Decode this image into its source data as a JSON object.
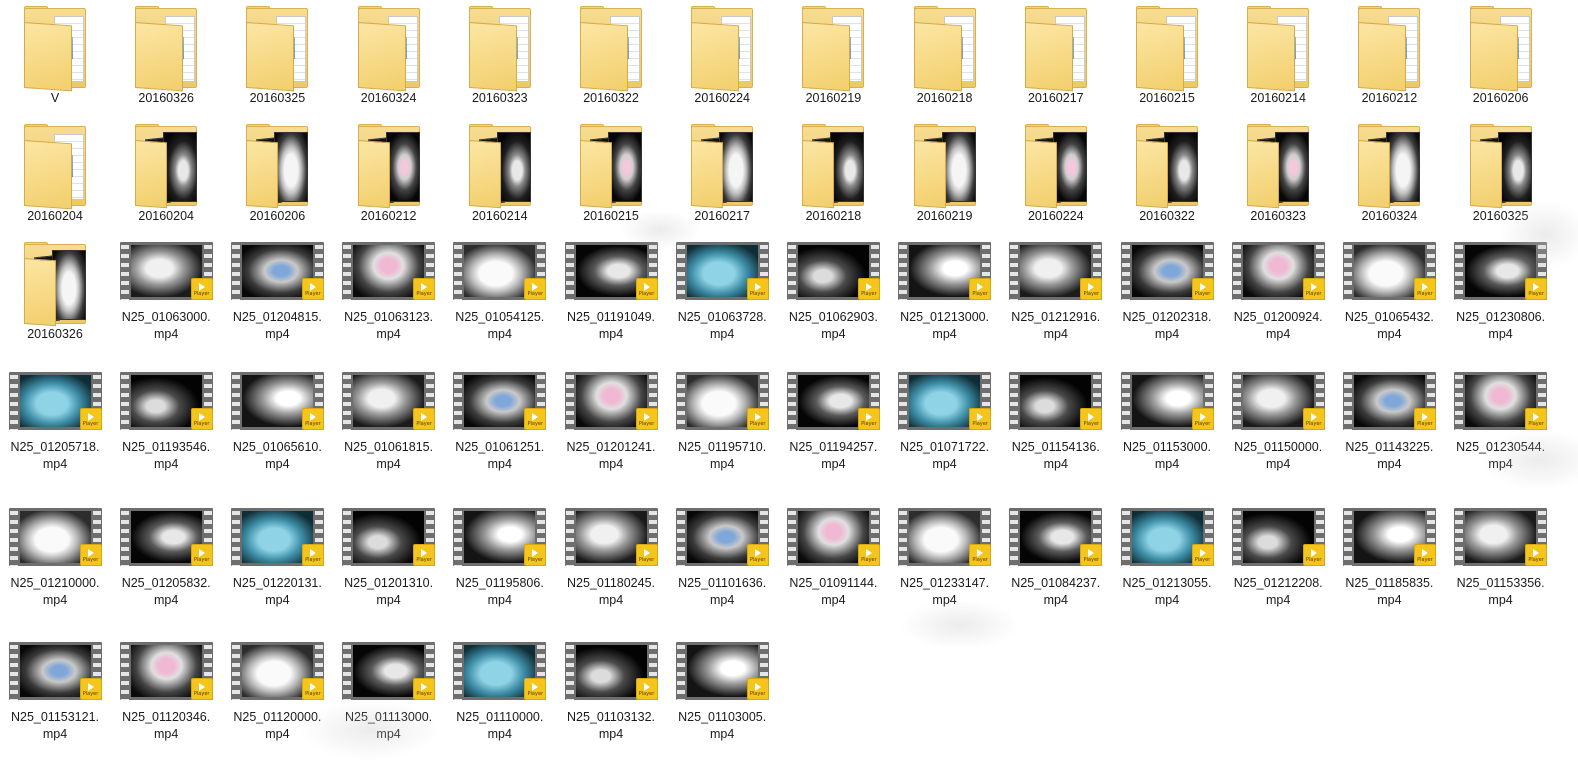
{
  "explorer": {
    "rows": [
      [
        {
          "kind": "folder",
          "label": "V"
        },
        {
          "kind": "folder",
          "label": "20160326"
        },
        {
          "kind": "folder",
          "label": "20160325"
        },
        {
          "kind": "folder",
          "label": "20160324"
        },
        {
          "kind": "folder",
          "label": "20160323"
        },
        {
          "kind": "folder",
          "label": "20160322"
        },
        {
          "kind": "folder",
          "label": "20160224"
        },
        {
          "kind": "folder",
          "label": "20160219"
        },
        {
          "kind": "folder",
          "label": "20160218"
        },
        {
          "kind": "folder",
          "label": "20160217"
        },
        {
          "kind": "folder",
          "label": "20160215"
        },
        {
          "kind": "folder",
          "label": "20160214"
        },
        {
          "kind": "folder",
          "label": "20160212"
        },
        {
          "kind": "folder",
          "label": "20160206"
        }
      ],
      [
        {
          "kind": "folder",
          "label": "20160204"
        },
        {
          "kind": "folder-photo",
          "label": "20160204"
        },
        {
          "kind": "folder-photo",
          "label": "20160206"
        },
        {
          "kind": "folder-photo",
          "label": "20160212"
        },
        {
          "kind": "folder-photo",
          "label": "20160214"
        },
        {
          "kind": "folder-photo",
          "label": "20160215"
        },
        {
          "kind": "folder-photo",
          "label": "20160217"
        },
        {
          "kind": "folder-photo",
          "label": "20160218"
        },
        {
          "kind": "folder-photo",
          "label": "20160219"
        },
        {
          "kind": "folder-photo",
          "label": "20160224"
        },
        {
          "kind": "folder-photo",
          "label": "20160322"
        },
        {
          "kind": "folder-photo",
          "label": "20160323"
        },
        {
          "kind": "folder-photo",
          "label": "20160324"
        },
        {
          "kind": "folder-photo",
          "label": "20160325"
        }
      ],
      [
        {
          "kind": "folder-photo",
          "label": "20160326"
        },
        {
          "kind": "video",
          "label": "N25_01063000.",
          "ext": "mp4"
        },
        {
          "kind": "video",
          "label": "N25_01204815.",
          "ext": "mp4"
        },
        {
          "kind": "video",
          "label": "N25_01063123.",
          "ext": "mp4"
        },
        {
          "kind": "video",
          "label": "N25_01054125.",
          "ext": "mp4"
        },
        {
          "kind": "video",
          "label": "N25_01191049.",
          "ext": "mp4"
        },
        {
          "kind": "video",
          "label": "N25_01063728.",
          "ext": "mp4"
        },
        {
          "kind": "video",
          "label": "N25_01062903.",
          "ext": "mp4"
        },
        {
          "kind": "video",
          "label": "N25_01213000.",
          "ext": "mp4"
        },
        {
          "kind": "video",
          "label": "N25_01212916.",
          "ext": "mp4"
        },
        {
          "kind": "video",
          "label": "N25_01202318.",
          "ext": "mp4"
        },
        {
          "kind": "video",
          "label": "N25_01200924.",
          "ext": "mp4"
        },
        {
          "kind": "video",
          "label": "N25_01065432.",
          "ext": "mp4"
        },
        {
          "kind": "video",
          "label": "N25_01230806.",
          "ext": "mp4"
        }
      ],
      [
        {
          "kind": "video",
          "label": "N25_01205718.",
          "ext": "mp4"
        },
        {
          "kind": "video",
          "label": "N25_01193546.",
          "ext": "mp4"
        },
        {
          "kind": "video",
          "label": "N25_01065610.",
          "ext": "mp4"
        },
        {
          "kind": "video",
          "label": "N25_01061815.",
          "ext": "mp4"
        },
        {
          "kind": "video",
          "label": "N25_01061251.",
          "ext": "mp4"
        },
        {
          "kind": "video",
          "label": "N25_01201241.",
          "ext": "mp4"
        },
        {
          "kind": "video",
          "label": "N25_01195710.",
          "ext": "mp4"
        },
        {
          "kind": "video",
          "label": "N25_01194257.",
          "ext": "mp4"
        },
        {
          "kind": "video",
          "label": "N25_01071722.",
          "ext": "mp4"
        },
        {
          "kind": "video",
          "label": "N25_01154136.",
          "ext": "mp4"
        },
        {
          "kind": "video",
          "label": "N25_01153000.",
          "ext": "mp4"
        },
        {
          "kind": "video",
          "label": "N25_01150000.",
          "ext": "mp4"
        },
        {
          "kind": "video",
          "label": "N25_01143225.",
          "ext": "mp4"
        },
        {
          "kind": "video",
          "label": "N25_01230544.",
          "ext": "mp4"
        }
      ],
      [
        {
          "kind": "video",
          "label": "N25_01210000.",
          "ext": "mp4"
        },
        {
          "kind": "video",
          "label": "N25_01205832.",
          "ext": "mp4"
        },
        {
          "kind": "video",
          "label": "N25_01220131.",
          "ext": "mp4"
        },
        {
          "kind": "video",
          "label": "N25_01201310.",
          "ext": "mp4"
        },
        {
          "kind": "video",
          "label": "N25_01195806.",
          "ext": "mp4"
        },
        {
          "kind": "video",
          "label": "N25_01180245.",
          "ext": "mp4"
        },
        {
          "kind": "video",
          "label": "N25_01101636.",
          "ext": "mp4"
        },
        {
          "kind": "video",
          "label": "N25_01091144.",
          "ext": "mp4"
        },
        {
          "kind": "video",
          "label": "N25_01233147.",
          "ext": "mp4"
        },
        {
          "kind": "video",
          "label": "N25_01084237.",
          "ext": "mp4"
        },
        {
          "kind": "video",
          "label": "N25_01213055.",
          "ext": "mp4"
        },
        {
          "kind": "video",
          "label": "N25_01212208.",
          "ext": "mp4"
        },
        {
          "kind": "video",
          "label": "N25_01185835.",
          "ext": "mp4"
        },
        {
          "kind": "video",
          "label": "N25_01153356.",
          "ext": "mp4"
        }
      ],
      [
        {
          "kind": "video",
          "label": "N25_01153121.",
          "ext": "mp4"
        },
        {
          "kind": "video",
          "label": "N25_01120346.",
          "ext": "mp4"
        },
        {
          "kind": "video",
          "label": "N25_01120000.",
          "ext": "mp4"
        },
        {
          "kind": "video",
          "label": "N25_01113000.",
          "ext": "mp4"
        },
        {
          "kind": "video",
          "label": "N25_01110000.",
          "ext": "mp4"
        },
        {
          "kind": "video",
          "label": "N25_01103132.",
          "ext": "mp4"
        },
        {
          "kind": "video",
          "label": "N25_01103005.",
          "ext": "mp4"
        }
      ]
    ],
    "badge_text": "Player",
    "colors": {
      "folder_yellow": "#f2cf6c",
      "badge_yellow": "#f4c51c",
      "filmstrip_gray": "#6e6e6e"
    },
    "icons": {
      "folder": "folder-icon",
      "video": "video-thumbnail-icon",
      "badge": "player-badge-icon"
    }
  }
}
